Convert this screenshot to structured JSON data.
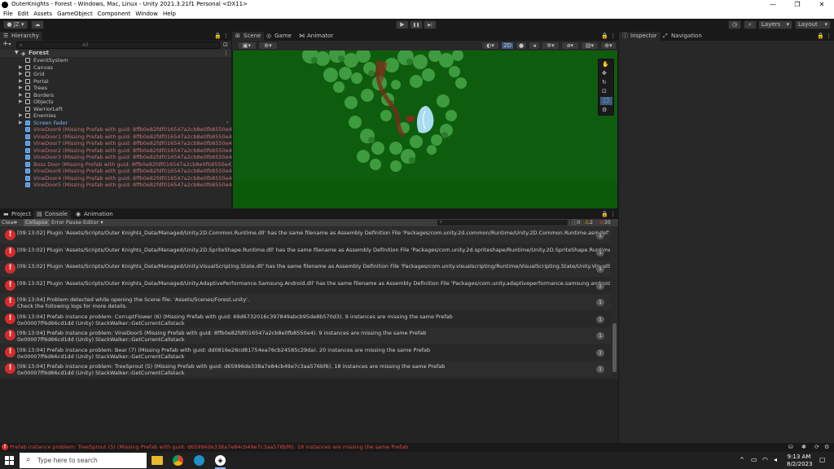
{
  "window": {
    "title": "OuterKnights - Forest - Windows, Mac, Linux - Unity 2021.3.21f1 Personal <DX11>",
    "minimize": "—",
    "maximize": "❐",
    "close": "✕"
  },
  "menu": [
    "File",
    "Edit",
    "Assets",
    "GameObject",
    "Component",
    "Window",
    "Help"
  ],
  "toolbar": {
    "account": "JZ",
    "cloud": "☁",
    "play": "▶",
    "pause": "❚❚",
    "step": "▶|",
    "layers": "Layers",
    "layout": "Layout"
  },
  "hierarchy": {
    "tab": "Hierarchy",
    "add": "+",
    "search_placeholder": "All",
    "scene": "Forest",
    "items": [
      {
        "label": "EventSystem",
        "type": "normal",
        "expand": false
      },
      {
        "label": "Canvas",
        "type": "normal",
        "expand": true
      },
      {
        "label": "Grid",
        "type": "normal",
        "expand": true
      },
      {
        "label": "Portal",
        "type": "normal",
        "expand": true
      },
      {
        "label": "Trees",
        "type": "normal",
        "expand": true
      },
      {
        "label": "Borders",
        "type": "normal",
        "expand": true
      },
      {
        "label": "Objects",
        "type": "normal",
        "expand": true
      },
      {
        "label": "WarriorLeft",
        "type": "normal",
        "expand": false
      },
      {
        "label": "Enemies",
        "type": "normal",
        "expand": true
      },
      {
        "label": "Screen Fader",
        "type": "prefab",
        "expand": true
      },
      {
        "label": "VineDoor8 (Missing Prefab with guid: 8ffb0e82fdf016547a2cb8e0fb8550e4)",
        "type": "missing",
        "expand": false
      },
      {
        "label": "VineDoor1 (Missing Prefab with guid: 8ffb0e82fdf016547a2cb8e0fb8550e4)",
        "type": "missing",
        "expand": false
      },
      {
        "label": "VineDoor7 (Missing Prefab with guid: 8ffb0e82fdf016547a2cb8e0fb8550e4)",
        "type": "missing",
        "expand": false
      },
      {
        "label": "VineDoor2 (Missing Prefab with guid: 8ffb0e82fdf016547a2cb8e0fb8550e4)",
        "type": "missing",
        "expand": false
      },
      {
        "label": "VineDoor3 (Missing Prefab with guid: 8ffb0e82fdf016547a2cb8e0fb8550e4)",
        "type": "missing",
        "expand": false
      },
      {
        "label": "Boss Door (Missing Prefab with guid: 8ffb0e82fdf016547a2cb8e0fb8550e4)",
        "type": "missing",
        "expand": false
      },
      {
        "label": "VineDoor6 (Missing Prefab with guid: 8ffb0e82fdf016547a2cb8e0fb8550e4)",
        "type": "missing",
        "expand": false
      },
      {
        "label": "VineDoor4 (Missing Prefab with guid: 8ffb0e82fdf016547a2cb8e0fb8550e4)",
        "type": "missing",
        "expand": false
      },
      {
        "label": "VineDoor5 (Missing Prefab with guid: 8ffb0e82fdf016547a2cb8e0fb8550e4)",
        "type": "missing",
        "expand": false
      }
    ]
  },
  "scene_tabs": [
    "Scene",
    "Game",
    "Animator"
  ],
  "scene_toolbar": {
    "mode2d": "2D"
  },
  "right_tabs": [
    "Inspector",
    "Navigation"
  ],
  "bottom_tabs": [
    "Project",
    "Console",
    "Animation"
  ],
  "console": {
    "clear": "Clear",
    "collapse": "Collapse",
    "error_pause": "Error Pause",
    "editor": "Editor",
    "info_count": "0",
    "warn_count": "2",
    "error_count": "30",
    "logs": [
      {
        "line1": "[09:13:02] Plugin 'Assets/Scripts/Outer Knights_Data/Managed/Unity.2D.Common.Runtime.dll' has the same filename as Assembly Definition File 'Packages/com.unity.2d.common/Runtime/Unity.2D.Common.Runtime.asmdef'. Rename the assemb",
        "line2": "",
        "count": "1"
      },
      {
        "line1": "[09:13:02] Plugin 'Assets/Scripts/Outer Knights_Data/Managed/Unity.2D.SpriteShape.Runtime.dll' has the same filename as Assembly Definition File 'Packages/com.unity.2d.spriteshape/Runtime/Unity.2D.SpriteShape.Runtime.asmdef'. Rename th",
        "line2": "",
        "count": "1"
      },
      {
        "line1": "[09:13:02] Plugin 'Assets/Scripts/Outer Knights_Data/Managed/Unity.VisualScripting.State.dll' has the same filename as Assembly Definition File 'Packages/com.unity.visualscripting/Runtime/VisualScripting.State/Unity.VisualScripting.State.asmd",
        "line2": "",
        "count": "1"
      },
      {
        "line1": "[09:13:02] Plugin 'Assets/Scripts/Outer Knights_Data/Managed/Unity.AdaptivePerformance.Samsung.Android.dll' has the same filename as Assembly Definition File 'Packages/com.unity.adaptiveperformance.samsung.android/Runtime/Unity.Adap",
        "line2": "",
        "count": "1"
      },
      {
        "line1": "[09:13:04] Problem detected while opening the Scene file: 'Assets/Scenes/Forest.unity'.",
        "line2": "Check the following logs for more details.",
        "count": "1"
      },
      {
        "line1": "[09:13:04] Prefab instance problem: CorruptFlower (6) (Missing Prefab with guid: 69d6732016c397849abcb95de8b570d3). 9 instances are missing the same Prefab",
        "line2": "0x00007ff6d66cd1dd (Unity) StackWalker::GetCurrentCallstack",
        "count": "1"
      },
      {
        "line1": "[09:13:04] Prefab instance problem: VineDoor5 (Missing Prefab with guid: 8ffb0e82fdf016547a2cb8e0fb8550e4). 9 instances are missing the same Prefab",
        "line2": "0x00007ff6d66cd1dd (Unity) StackWalker::GetCurrentCallstack",
        "count": "1"
      },
      {
        "line1": "[09:13:04] Prefab instance problem: Bear (7) (Missing Prefab with guid: dd0816e26cd81754ea76cb24585c29da). 20 instances are missing the same Prefab",
        "line2": "0x00007ff6d66cd1dd (Unity) StackWalker::GetCurrentCallstack",
        "count": "1"
      },
      {
        "line1": "[09:13:04] Prefab instance problem: TreeSprout (5) (Missing Prefab with guid: d65996de338a7e84cb49e7c3aa576bf6). 18 instances are missing the same Prefab",
        "line2": "0x00007ff6d66cd1dd (Unity) StackWalker::GetCurrentCallstack",
        "count": "1"
      }
    ]
  },
  "statusbar": {
    "message": "Prefab instance problem: TreeSprout (5) (Missing Prefab with guid: d65996de338a7e84cb49e7c3aa576bf6). 18 instances are missing the same Prefab"
  },
  "taskbar": {
    "search_placeholder": "Type here to search",
    "time": "9:13 AM",
    "date": "8/2/2023"
  },
  "colors": {
    "error": "#d42c2c",
    "missing_prefab": "#c67474",
    "prefab": "#7cb7f0",
    "scene_bg": "#0e5d0e",
    "accent": "#3d85e0"
  }
}
